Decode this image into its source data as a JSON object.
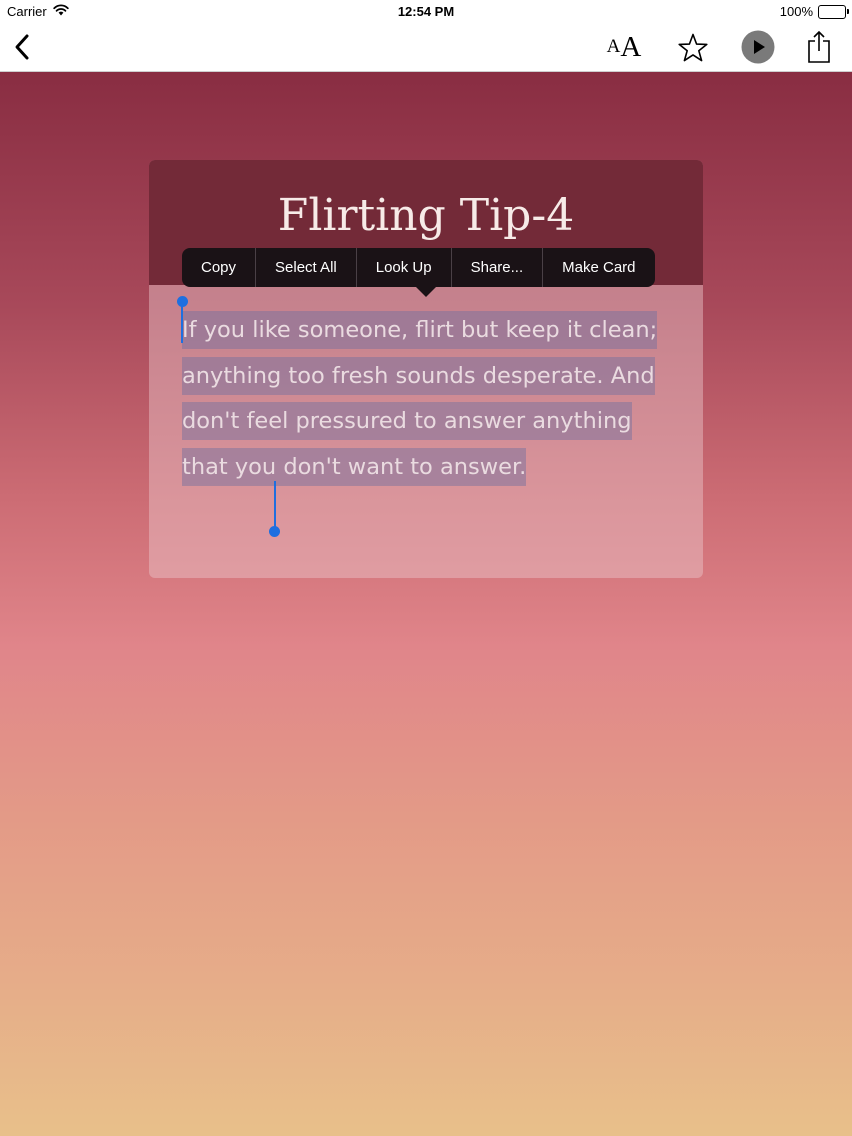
{
  "status_bar": {
    "carrier": "Carrier",
    "wifi_icon": "wifi-icon",
    "time": "12:54 PM",
    "battery_percent": "100%",
    "battery_icon": "battery-icon"
  },
  "nav_bar": {
    "back_icon": "chevron-left-icon",
    "font_size_small": "A",
    "font_size_big": "A",
    "favorite_icon": "star-icon",
    "play_icon": "play-icon",
    "share_icon": "share-icon"
  },
  "card": {
    "title": "Flirting Tip-4",
    "body": "If you like someone, flirt but keep it clean; anything too fresh sounds desperate. And don't feel pressured to answer anything that you don't want to answer."
  },
  "context_menu": {
    "items": [
      {
        "label": "Copy"
      },
      {
        "label": "Select All"
      },
      {
        "label": "Look Up"
      },
      {
        "label": "Share..."
      },
      {
        "label": "Make Card"
      }
    ]
  },
  "colors": {
    "header": "#732a38",
    "selection_handle": "#1e6fe0",
    "menu_bg": "#1a1216",
    "gradient_top": "#892d42",
    "gradient_bottom": "#e8c08a"
  }
}
